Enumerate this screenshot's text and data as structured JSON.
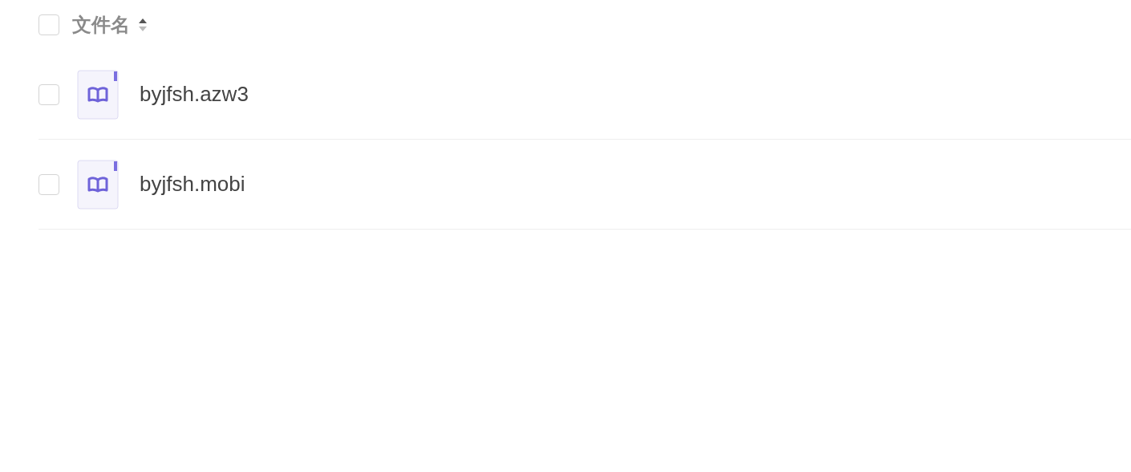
{
  "header": {
    "label": "文件名",
    "checked": false,
    "sort_ascending": true
  },
  "files": [
    {
      "name": "byjfsh.azw3",
      "checked": false
    },
    {
      "name": "byjfsh.mobi",
      "checked": false
    }
  ]
}
